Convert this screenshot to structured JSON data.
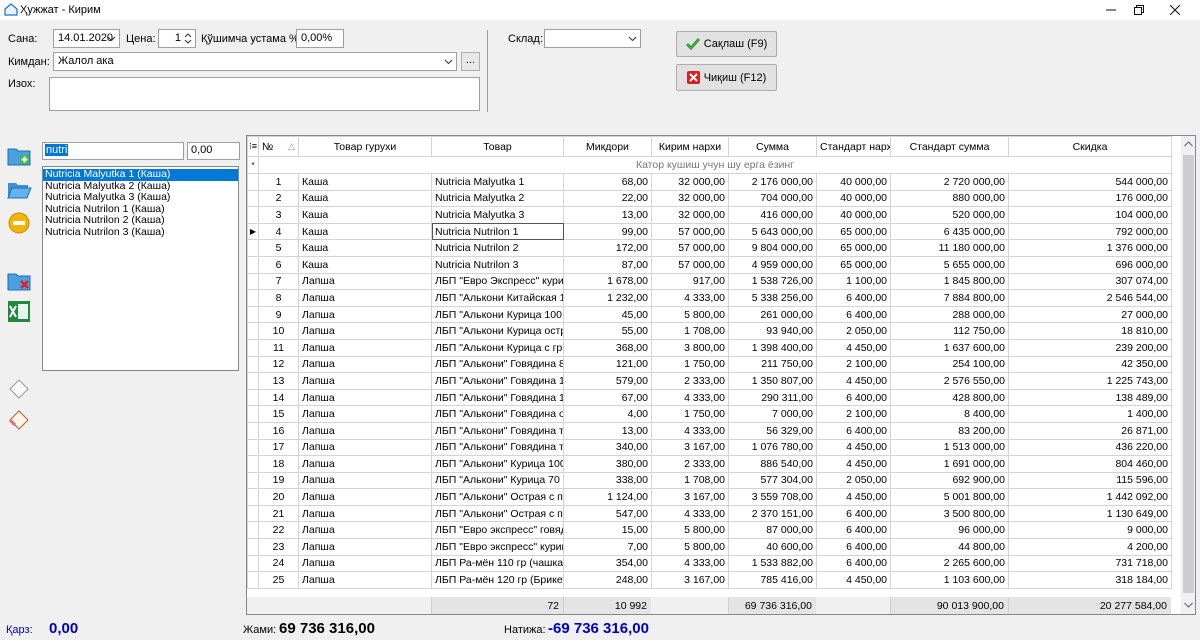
{
  "window": {
    "title": "Ҳужжат - Кирим"
  },
  "form": {
    "date_label": "Сана:",
    "date_value": "14.01.2020",
    "price_label": "Цена:",
    "price_value": "1",
    "extra_label": "Қўшимча устама %:",
    "extra_value": "0,00%",
    "from_label": "Кимдан:",
    "from_value": "Жалол ака",
    "browse_label": "...",
    "note_label": "Изох:",
    "note_value": "",
    "warehouse_label": "Склад:",
    "warehouse_value": ""
  },
  "buttons": {
    "save": "Сақлаш (F9)",
    "exit": "Чиқиш (F12)"
  },
  "search": {
    "value": "nutri",
    "amount": "0,00"
  },
  "product_list": [
    "Nutricia Malyutka 1 (Каша)",
    "Nutricia Malyutka 2 (Каша)",
    "Nutricia Malyutka 3 (Каша)",
    "Nutricia Nutrilon 1 (Каша)",
    "Nutricia Nutrilon 2 (Каша)",
    "Nutricia Nutrilon 3 (Каша)"
  ],
  "grid": {
    "columns": [
      "№",
      "Товар гурухи",
      "Товар",
      "Микдори",
      "Кирим нархи",
      "Сумма",
      "Стандарт нарх",
      "Стандарт сумма",
      "Скидка"
    ],
    "new_row_text": "Катор кушиш учун шу ерга ёзинг",
    "rows": [
      [
        "1",
        "Каша",
        "Nutricia Malyutka 1",
        "68,00",
        "32 000,00",
        "2 176 000,00",
        "40 000,00",
        "2 720 000,00",
        "544 000,00"
      ],
      [
        "2",
        "Каша",
        "Nutricia Malyutka 2",
        "22,00",
        "32 000,00",
        "704 000,00",
        "40 000,00",
        "880 000,00",
        "176 000,00"
      ],
      [
        "3",
        "Каша",
        "Nutricia Malyutka 3",
        "13,00",
        "32 000,00",
        "416 000,00",
        "40 000,00",
        "520 000,00",
        "104 000,00"
      ],
      [
        "4",
        "Каша",
        "Nutricia Nutrilon 1",
        "99,00",
        "57 000,00",
        "5 643 000,00",
        "65 000,00",
        "6 435 000,00",
        "792 000,00"
      ],
      [
        "5",
        "Каша",
        "Nutricia Nutrilon 2",
        "172,00",
        "57 000,00",
        "9 804 000,00",
        "65 000,00",
        "11 180 000,00",
        "1 376 000,00"
      ],
      [
        "6",
        "Каша",
        "Nutricia Nutrilon 3",
        "87,00",
        "57 000,00",
        "4 959 000,00",
        "65 000,00",
        "5 655 000,00",
        "696 000,00"
      ],
      [
        "7",
        "Лапша",
        "ЛБП \"Евро Экспресс\" курица",
        "1 678,00",
        "917,00",
        "1 538 726,00",
        "1 100,00",
        "1 845 800,00",
        "307 074,00"
      ],
      [
        "8",
        "Лапша",
        "ЛБП \"Алькони Китайская 10",
        "1 232,00",
        "4 333,00",
        "5 338 256,00",
        "6 400,00",
        "7 884 800,00",
        "2 546 544,00"
      ],
      [
        "9",
        "Лапша",
        "ЛБП \"Алькони Курица 100 гр",
        "45,00",
        "5 800,00",
        "261 000,00",
        "6 400,00",
        "288 000,00",
        "27 000,00"
      ],
      [
        "10",
        "Лапша",
        "ЛБП \"Алькони Курица острая",
        "55,00",
        "1 708,00",
        "93 940,00",
        "2 050,00",
        "112 750,00",
        "18 810,00"
      ],
      [
        "11",
        "Лапша",
        "ЛБП \"Алькони Курица с гриб",
        "368,00",
        "3 800,00",
        "1 398 400,00",
        "4 450,00",
        "1 637 600,00",
        "239 200,00"
      ],
      [
        "12",
        "Лапша",
        "ЛБП \"Алькони\" Говядина 85",
        "121,00",
        "1 750,00",
        "211 750,00",
        "2 100,00",
        "254 100,00",
        "42 350,00"
      ],
      [
        "13",
        "Лапша",
        "ЛБП \"Алькони\" Говядина 10С",
        "579,00",
        "2 333,00",
        "1 350 807,00",
        "4 450,00",
        "2 576 550,00",
        "1 225 743,00"
      ],
      [
        "14",
        "Лапша",
        "ЛБП \"Алькони\" Говядина 10С",
        "67,00",
        "4 333,00",
        "290 311,00",
        "6 400,00",
        "428 800,00",
        "138 489,00"
      ],
      [
        "15",
        "Лапша",
        "ЛБП \"Алькони\" Говядина ост",
        "4,00",
        "1 750,00",
        "7 000,00",
        "2 100,00",
        "8 400,00",
        "1 400,00"
      ],
      [
        "16",
        "Лапша",
        "ЛБП \"Алькони\" Говядина туш",
        "13,00",
        "4 333,00",
        "56 329,00",
        "6 400,00",
        "83 200,00",
        "26 871,00"
      ],
      [
        "17",
        "Лапша",
        "ЛБП \"Алькони\" Говядина туш",
        "340,00",
        "3 167,00",
        "1 076 780,00",
        "4 450,00",
        "1 513 000,00",
        "436 220,00"
      ],
      [
        "18",
        "Лапша",
        "ЛБП \"Алькони\" Курица 100 гр",
        "380,00",
        "2 333,00",
        "886 540,00",
        "4 450,00",
        "1 691 000,00",
        "804 460,00"
      ],
      [
        "19",
        "Лапша",
        "ЛБП \"Алькони\" Курица 70 гр",
        "338,00",
        "1 708,00",
        "577 304,00",
        "2 050,00",
        "692 900,00",
        "115 596,00"
      ],
      [
        "20",
        "Лапша",
        "ЛБП \"Алькони\" Острая с пер",
        "1 124,00",
        "3 167,00",
        "3 559 708,00",
        "4 450,00",
        "5 001 800,00",
        "1 442 092,00"
      ],
      [
        "21",
        "Лапша",
        "ЛБП \"Алькони\" Острая с пер",
        "547,00",
        "4 333,00",
        "2 370 151,00",
        "6 400,00",
        "3 500 800,00",
        "1 130 649,00"
      ],
      [
        "22",
        "Лапша",
        "ЛБП \"Евро экспресс\" говядин",
        "15,00",
        "5 800,00",
        "87 000,00",
        "6 400,00",
        "96 000,00",
        "9 000,00"
      ],
      [
        "23",
        "Лапша",
        "ЛБП \"Евро экспресс\" курица",
        "7,00",
        "5 800,00",
        "40 600,00",
        "6 400,00",
        "44 800,00",
        "4 200,00"
      ],
      [
        "24",
        "Лапша",
        "ЛБП Ра-мён 110 гр (чашка)",
        "354,00",
        "4 333,00",
        "1 533 882,00",
        "6 400,00",
        "2 265 600,00",
        "731 718,00"
      ],
      [
        "25",
        "Лапша",
        "ЛБП Ра-мён 120 гр (Брикет)",
        "248,00",
        "3 167,00",
        "785 416,00",
        "4 450,00",
        "1 103 600,00",
        "318 184,00"
      ]
    ],
    "totals": {
      "count": "72",
      "quantity": "10 992",
      "sum": "69 736 316,00",
      "standard_sum": "90 013 900,00",
      "discount": "20 277 584,00"
    }
  },
  "status": {
    "debt_label": "Қарз:",
    "debt_value": "0,00",
    "total_label": "Жами:",
    "total_value": "69 736 316,00",
    "result_label": "Натижа:",
    "result_value": "-69 736 316,00"
  },
  "colors": {
    "selection": "#0078d7",
    "accent_blue": "#0000c0",
    "save_icon": "#3fa33f",
    "exit_icon": "#d82020"
  }
}
